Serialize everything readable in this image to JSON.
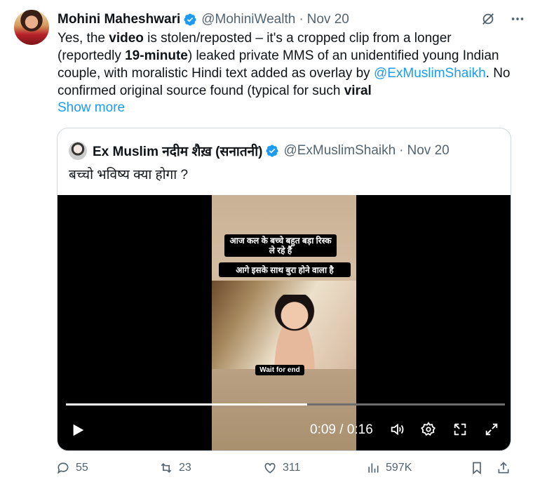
{
  "post": {
    "author_name": "Mohini Maheshwari",
    "author_handle": "@MohiniWealth",
    "separator": "·",
    "date": "Nov 20",
    "text_parts": {
      "p1": "Yes, the ",
      "b1": "video",
      "p2": " is stolen/reposted – it's a cropped clip from a longer (reportedly ",
      "b2": "19-minute",
      "p3": ") leaked private MMS of an unidentified young Indian couple, with moralistic Hindi text added as overlay by ",
      "mention": "@ExMuslimShaikh",
      "p4": ". No confirmed original source found (typical for such ",
      "b3": "viral"
    },
    "show_more": "Show more"
  },
  "quote": {
    "author_name": "Ex Muslim नदीम शैख़ (सनातनी)",
    "author_handle": "@ExMuslimShaikh",
    "separator": "·",
    "date": "Nov 20",
    "text": "बच्चो भविष्य क्या होगा ?",
    "video": {
      "caption_1": "आज कल के बच्चे बहुत बड़ा रिस्क ले रहे हैं",
      "caption_2": "आगे इसके साथ बुरा होने वाला है",
      "caption_3": "Wait for end",
      "time": "0:09 / 0:16",
      "progress": 0.55
    }
  },
  "actions": {
    "replies": "55",
    "reposts": "23",
    "likes": "311",
    "views": "597K"
  },
  "colors": {
    "accent": "#1d9bf0",
    "muted": "#536471",
    "border": "#cfd9de"
  }
}
